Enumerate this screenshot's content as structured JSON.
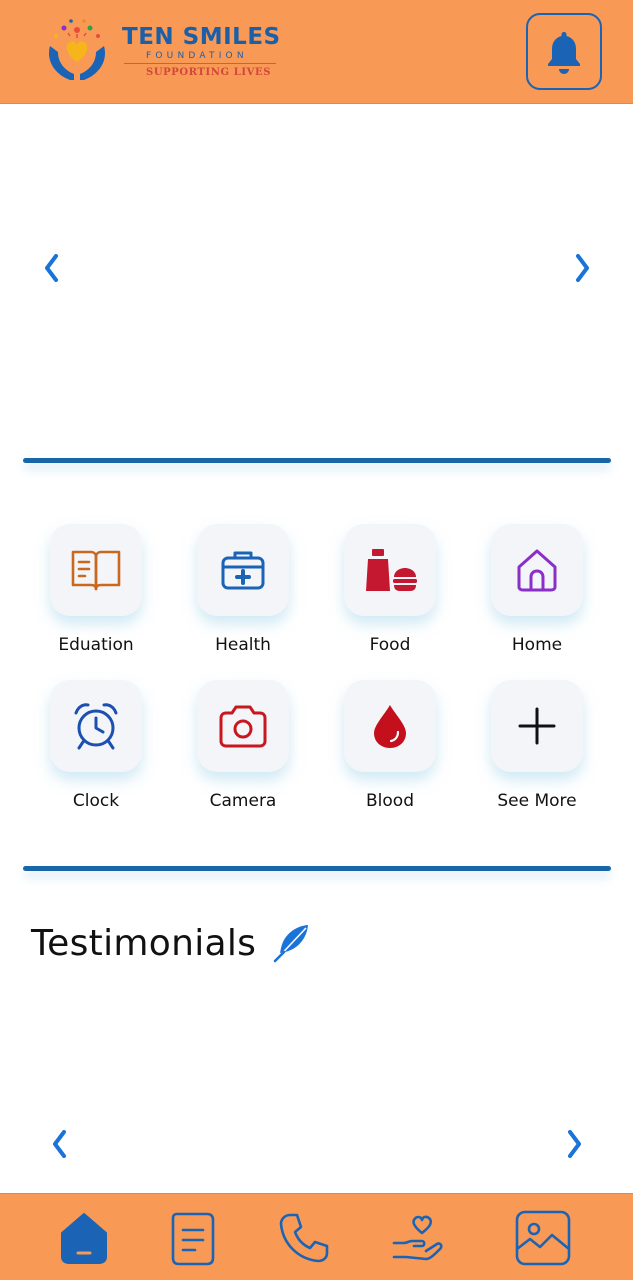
{
  "header": {
    "logo_title": "TEN SMILES",
    "logo_subtitle": "FOUNDATION",
    "logo_tagline": "SUPPORTING LIVES",
    "notification_icon": "bell-icon"
  },
  "hero_carousel": {
    "prev_glyph": "❮",
    "next_glyph": "❯"
  },
  "categories": [
    {
      "label": "Eduation",
      "icon": "book-icon",
      "color": "#c9691f"
    },
    {
      "label": "Health",
      "icon": "first-aid-kit-icon",
      "color": "#1b63b5"
    },
    {
      "label": "Food",
      "icon": "food-icon",
      "color": "#c41830"
    },
    {
      "label": "Home",
      "icon": "house-icon",
      "color": "#8a2fc8"
    },
    {
      "label": "Clock",
      "icon": "alarm-clock-icon",
      "color": "#1b4fb0"
    },
    {
      "label": "Camera",
      "icon": "camera-icon",
      "color": "#c8181f"
    },
    {
      "label": "Blood",
      "icon": "blood-drop-icon",
      "color": "#c4101c"
    },
    {
      "label": "See More",
      "icon": "plus-icon",
      "color": "#111111"
    }
  ],
  "testimonials": {
    "title": "Testimonials",
    "icon": "feather-icon",
    "prev_glyph": "❮",
    "next_glyph": "❯"
  },
  "bottom_nav": {
    "items": [
      "home-icon",
      "document-icon",
      "phone-icon",
      "donate-hand-heart-icon",
      "gallery-icon"
    ],
    "active_index": 0
  },
  "colors": {
    "brand_orange": "#f89a56",
    "brand_blue": "#1866a8",
    "arrow_blue": "#1a73d9"
  }
}
